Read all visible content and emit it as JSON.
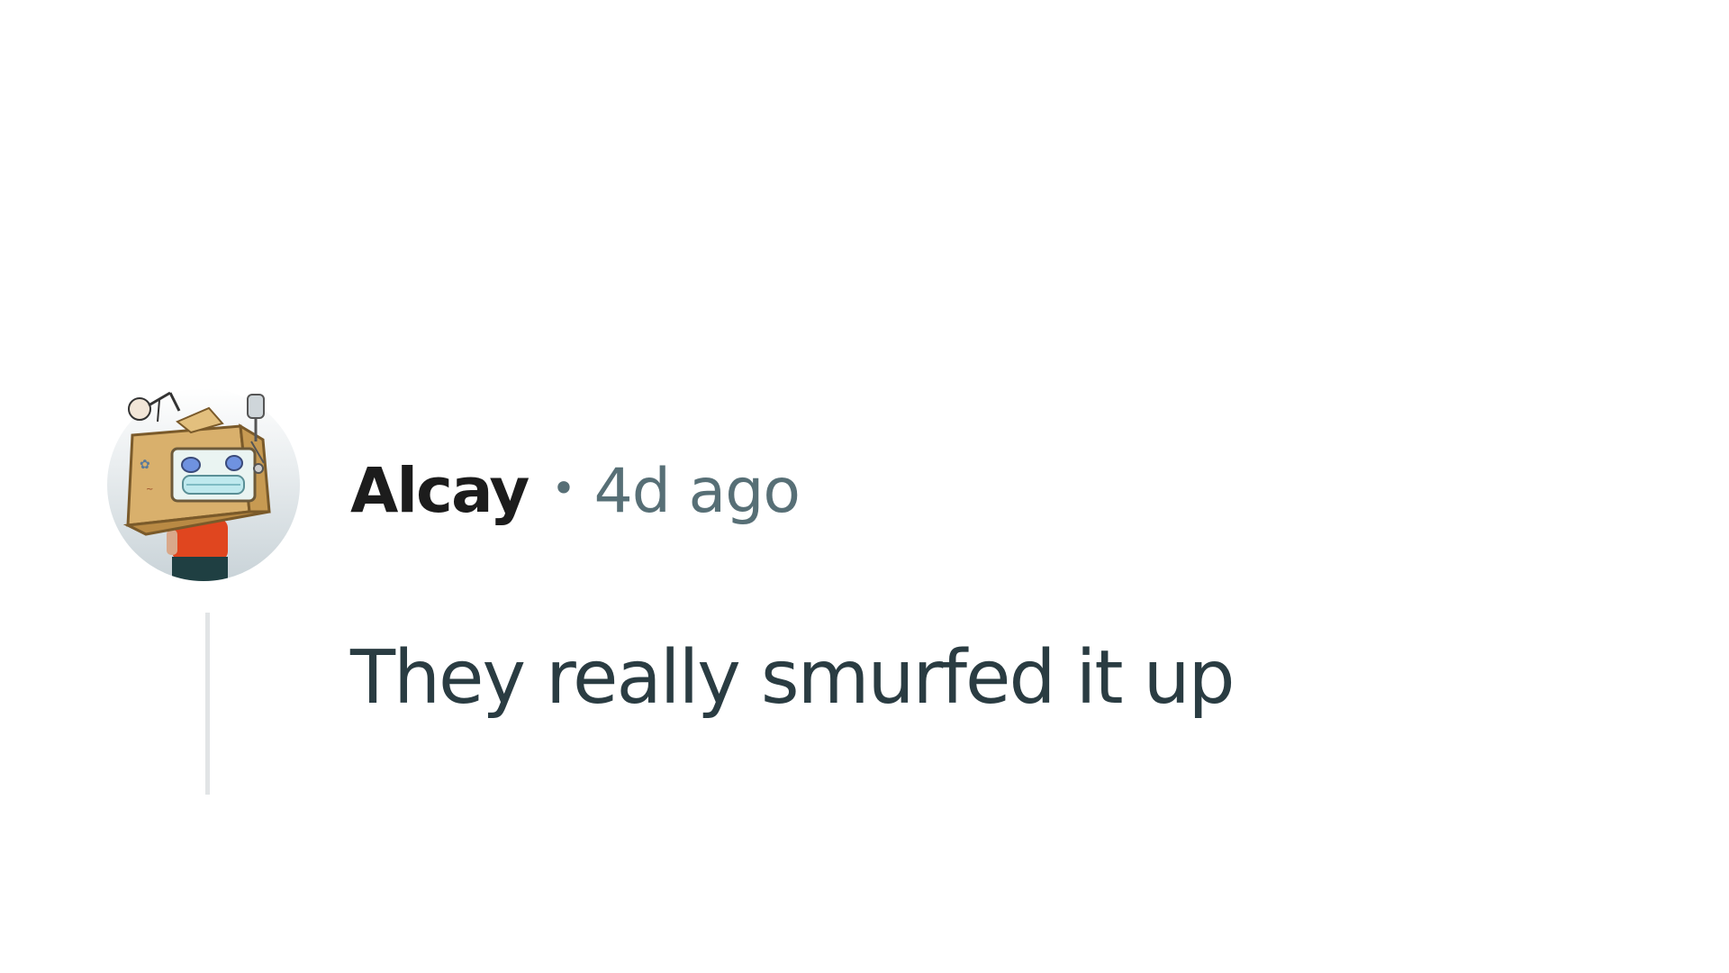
{
  "comment": {
    "author": "Alcay",
    "separator": "•",
    "timestamp": "4d ago",
    "body": "They really smurfed it up",
    "avatar_icon": "snoo-avatar-icon"
  },
  "colors": {
    "author": "#1c1c1c",
    "meta": "#576f76",
    "body": "#2a3c42",
    "thread_line": "#e1e4e6",
    "background": "#ffffff"
  }
}
